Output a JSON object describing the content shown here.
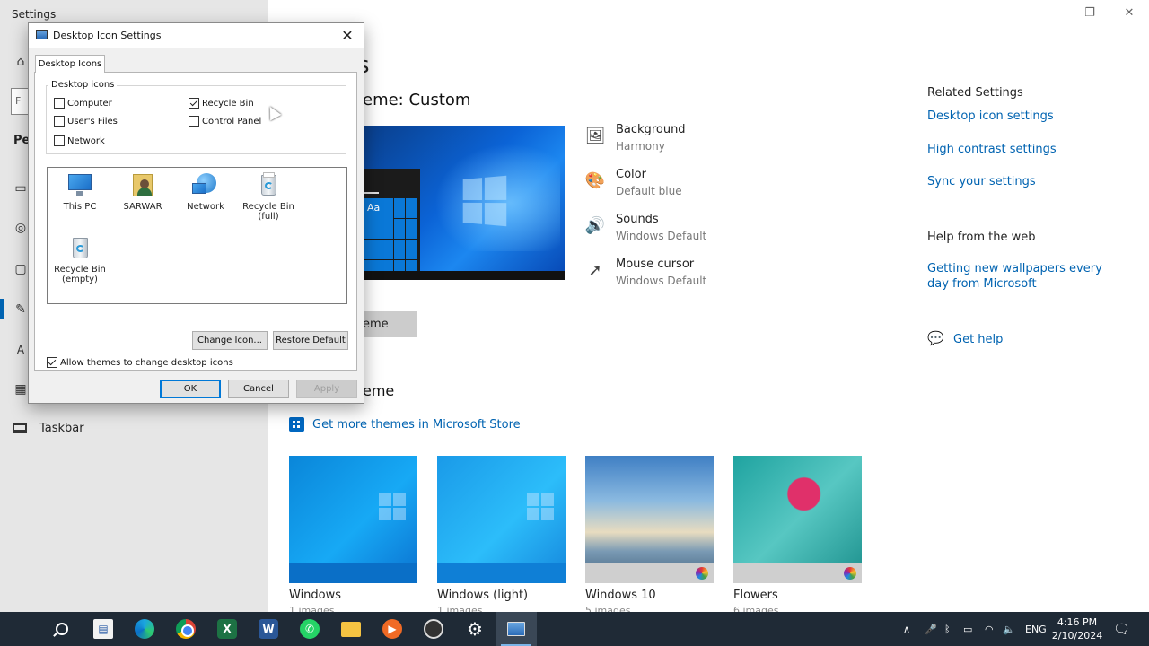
{
  "settings": {
    "app_title": "Settings",
    "search_stub": "F",
    "section_stub": "Per",
    "taskbar_label": "Taskbar",
    "page_heading_stub": "s",
    "window_controls": [
      "—",
      "❐",
      "✕"
    ]
  },
  "themes": {
    "current_theme": "eme: Custom",
    "preview_tile": "Aa",
    "save_button_stub": "eme",
    "properties": [
      {
        "title": "Background",
        "value": "Harmony",
        "icon": "picture-icon"
      },
      {
        "title": "Color",
        "value": "Default blue",
        "icon": "palette-icon"
      },
      {
        "title": "Sounds",
        "value": "Windows Default",
        "icon": "speaker-icon"
      },
      {
        "title": "Mouse cursor",
        "value": "Windows Default",
        "icon": "cursor-icon"
      }
    ],
    "apply_heading_stub": "eme",
    "store_link": "Get more themes in Microsoft Store",
    "cards": [
      {
        "name": "Windows",
        "count": "1 images"
      },
      {
        "name": "Windows (light)",
        "count": "1 images"
      },
      {
        "name": "Windows 10",
        "count": "5 images"
      },
      {
        "name": "Flowers",
        "count": "6 images"
      }
    ]
  },
  "related": {
    "heading": "Related Settings",
    "links": [
      "Desktop icon settings",
      "High contrast settings",
      "Sync your settings"
    ],
    "web_heading": "Help from the web",
    "web_link": "Getting new wallpapers every day from Microsoft",
    "get_help": "Get help"
  },
  "dialog": {
    "title": "Desktop Icon Settings",
    "tab": "Desktop Icons",
    "group_label": "Desktop icons",
    "checkboxes": [
      {
        "label": "Computer",
        "checked": false
      },
      {
        "label": "Recycle Bin",
        "checked": true
      },
      {
        "label": "User's Files",
        "checked": false
      },
      {
        "label": "Control Panel",
        "checked": false
      },
      {
        "label": "Network",
        "checked": false
      }
    ],
    "icons": [
      {
        "line1": "This PC",
        "line2": ""
      },
      {
        "line1": "SARWAR",
        "line2": ""
      },
      {
        "line1": "Network",
        "line2": ""
      },
      {
        "line1": "Recycle Bin",
        "line2": "(full)"
      },
      {
        "line1": "Recycle Bin",
        "line2": "(empty)"
      }
    ],
    "change_icon": "Change Icon...",
    "restore_default": "Restore Default",
    "allow_themes": "Allow themes to change desktop icons",
    "allow_themes_checked": true,
    "ok": "OK",
    "cancel": "Cancel",
    "apply": "Apply"
  },
  "taskbar": {
    "word_glyph": "W",
    "excel_glyph": "X",
    "tray_language": "ENG",
    "time": "4:16 PM",
    "date": "2/10/2024"
  }
}
